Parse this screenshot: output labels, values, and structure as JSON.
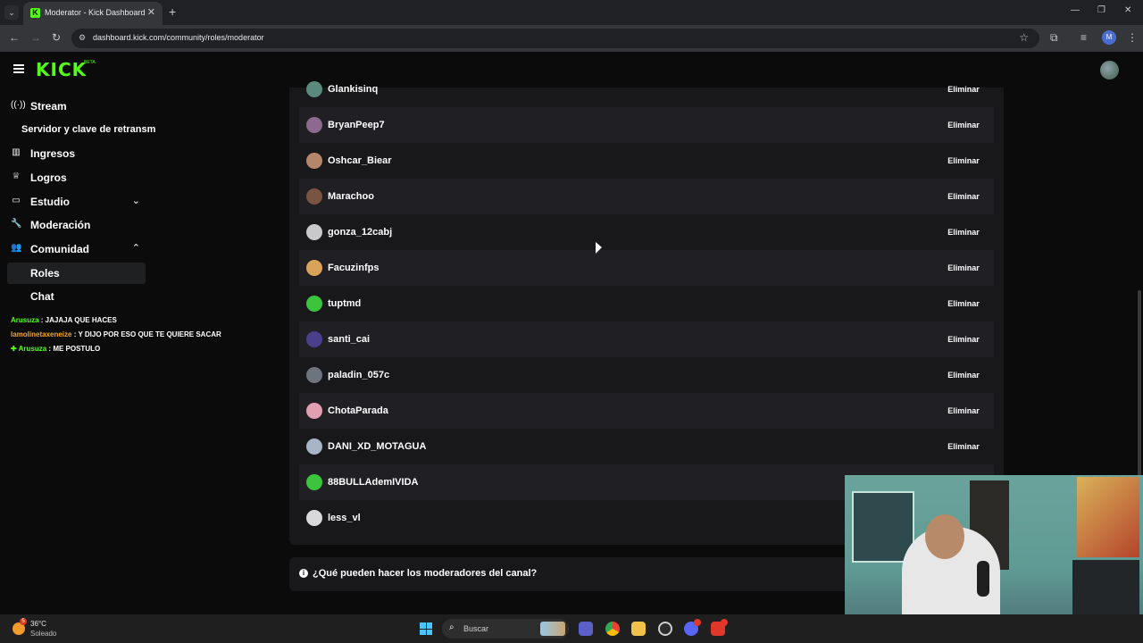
{
  "browser": {
    "tab_title": "Moderator - Kick Dashboard",
    "url": "dashboard.kick.com/community/roles/moderator",
    "profile_initial": "M"
  },
  "header": {
    "logo": "KICK",
    "logo_badge": "BETA"
  },
  "sidebar": {
    "items": [
      {
        "label": "Stream",
        "icon": "broadcast-icon"
      },
      {
        "label": "Servidor y clave de retransm"
      },
      {
        "label": "Ingresos",
        "icon": "chart-icon"
      },
      {
        "label": "Logros",
        "icon": "trophy-icon"
      },
      {
        "label": "Estudio",
        "icon": "studio-icon"
      },
      {
        "label": "Moderación",
        "icon": "wrench-icon"
      },
      {
        "label": "Comunidad",
        "icon": "people-icon"
      },
      {
        "label": "Roles"
      },
      {
        "label": "Chat"
      }
    ]
  },
  "chat_overlay": [
    {
      "user": "Arusuza",
      "text": "JAJAJA QUE HACES",
      "user_color": "#53fc18"
    },
    {
      "user": "lamolinetaxeneize",
      "text": "Y DIJO POR ESO QUE TE QUIERE SACAR",
      "user_color": "#f5a623"
    },
    {
      "user": "Arusuza",
      "text": "ME POSTULO",
      "user_color": "#53fc18"
    }
  ],
  "moderators": {
    "remove_label": "Eliminar",
    "rows": [
      {
        "name": "Glankisinq",
        "avatar_color": "#5a8a7d",
        "removable": true
      },
      {
        "name": "BryanPeep7",
        "avatar_color": "#8c6a8f",
        "removable": true
      },
      {
        "name": "Oshcar_Biear",
        "avatar_color": "#b5876a",
        "removable": true
      },
      {
        "name": "Marachoo",
        "avatar_color": "#7a5342",
        "removable": true
      },
      {
        "name": "gonza_12cabj",
        "avatar_color": "#c9c9c9",
        "removable": true
      },
      {
        "name": "Facuzinfps",
        "avatar_color": "#d9a45a",
        "removable": true
      },
      {
        "name": "tuptmd",
        "avatar_color": "#3cc43c",
        "removable": true
      },
      {
        "name": "santi_cai",
        "avatar_color": "#4a3f8a",
        "removable": true
      },
      {
        "name": "paladin_057c",
        "avatar_color": "#6d7480",
        "removable": true
      },
      {
        "name": "ChotaParada",
        "avatar_color": "#e0a0b0",
        "removable": true
      },
      {
        "name": "DANI_XD_MOTAGUA",
        "avatar_color": "#a8b5c7",
        "removable": true
      },
      {
        "name": "88BULLAdemIVIDA",
        "avatar_color": "#3cc43c",
        "removable": false
      },
      {
        "name": "less_vl",
        "avatar_color": "#d9d9d9",
        "removable": false
      }
    ]
  },
  "faq": {
    "question": "¿Qué pueden hacer los moderadores del canal?"
  },
  "taskbar": {
    "weather_temp": "36°C",
    "weather_desc": "Soleado",
    "weather_badge": "5",
    "search_placeholder": "Buscar"
  }
}
